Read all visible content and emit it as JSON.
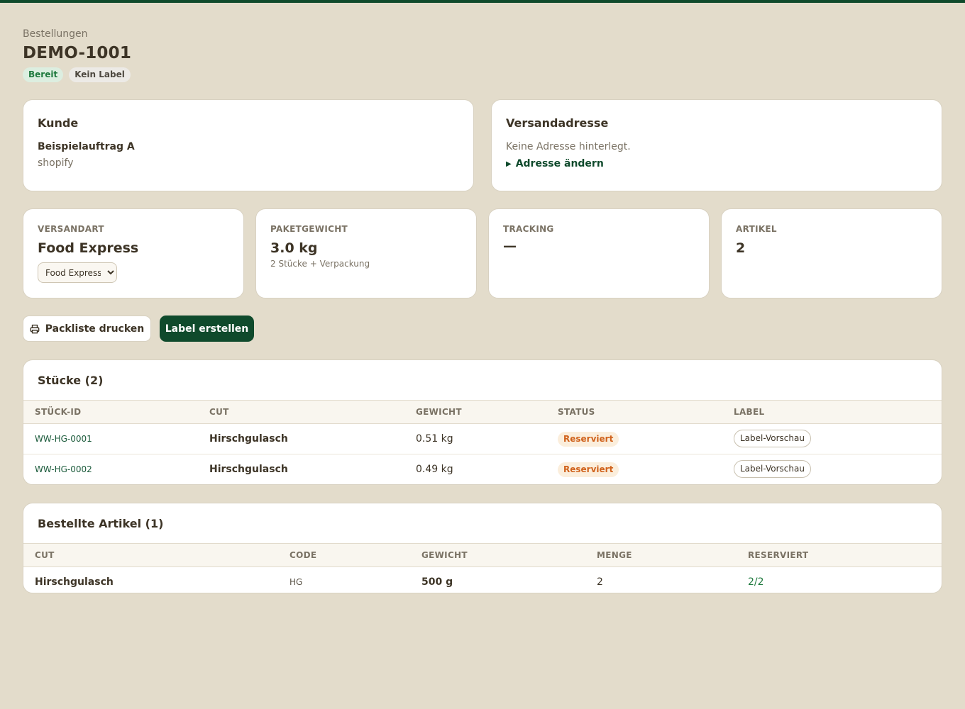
{
  "breadcrumb": "Bestellungen",
  "page_title": "DEMO-1001",
  "badges": {
    "status": "Bereit",
    "label": "Kein Label"
  },
  "customer": {
    "title": "Kunde",
    "name": "Beispielauftrag A",
    "source": "shopify"
  },
  "address": {
    "title": "Versandadresse",
    "empty_text": "Keine Adresse hinterlegt.",
    "change_label": "Adresse ändern"
  },
  "stats": {
    "shipping": {
      "label": "VERSANDART",
      "value": "Food Express",
      "select_value": "Food Express"
    },
    "weight": {
      "label": "PAKETGEWICHT",
      "value": "3.0 kg",
      "sub": "2 Stücke + Verpackung"
    },
    "tracking": {
      "label": "TRACKING",
      "value": "—"
    },
    "items": {
      "label": "ARTIKEL",
      "value": "2"
    }
  },
  "actions": {
    "print_label": "Packliste drucken",
    "create_label": "Label erstellen"
  },
  "pieces": {
    "title": "Stücke (2)",
    "columns": [
      "STÜCK-ID",
      "CUT",
      "GEWICHT",
      "STATUS",
      "LABEL"
    ],
    "rows": [
      {
        "id": "WW-HG-0001",
        "cut": "Hirschgulasch",
        "weight": "0.51 kg",
        "status": "Reserviert",
        "label": "Label-Vorschau"
      },
      {
        "id": "WW-HG-0002",
        "cut": "Hirschgulasch",
        "weight": "0.49 kg",
        "status": "Reserviert",
        "label": "Label-Vorschau"
      }
    ]
  },
  "ordered": {
    "title": "Bestellte Artikel (1)",
    "columns": [
      "CUT",
      "CODE",
      "GEWICHT",
      "MENGE",
      "RESERVIERT"
    ],
    "rows": [
      {
        "cut": "Hirschgulasch",
        "code": "HG",
        "weight": "500 g",
        "quantity": "2",
        "reserved": "2/2"
      }
    ]
  },
  "colors": {
    "accent": "#0f4a2c",
    "background": "#e3dccb",
    "status_ready": "#1f7a3e",
    "status_reserved": "#d0621c"
  }
}
